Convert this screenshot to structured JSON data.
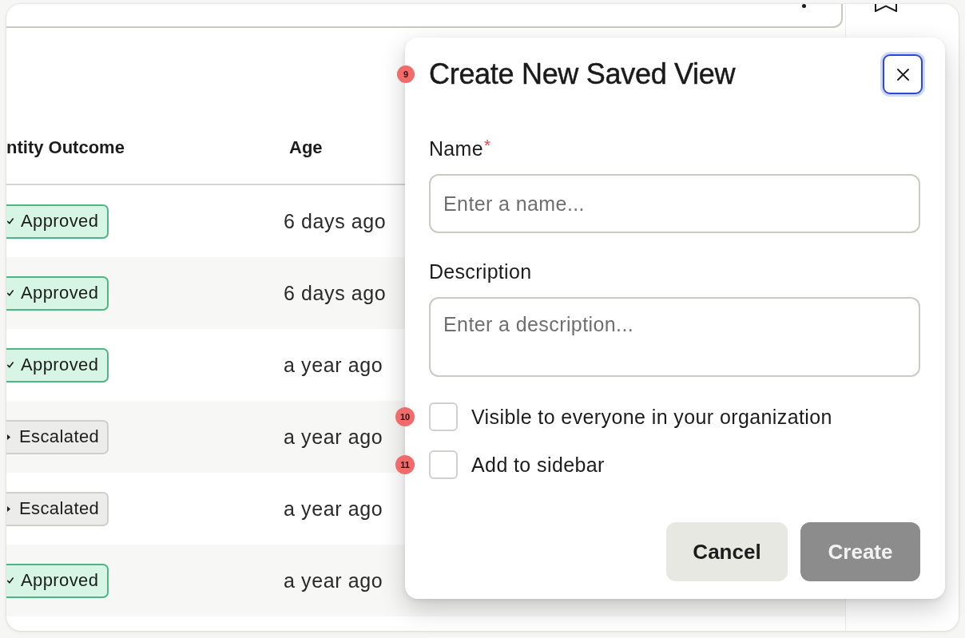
{
  "table": {
    "columns": [
      "ntity Outcome",
      "Age"
    ],
    "rows": [
      {
        "outcome": {
          "label": "Approved",
          "kind": "approved"
        },
        "age": "6 days ago"
      },
      {
        "outcome": {
          "label": "Approved",
          "kind": "approved"
        },
        "age": "6 days ago"
      },
      {
        "outcome": {
          "label": "Approved",
          "kind": "approved"
        },
        "age": "a year ago"
      },
      {
        "outcome": {
          "label": "Escalated",
          "kind": "escalated"
        },
        "age": "a year ago"
      },
      {
        "outcome": {
          "label": "Escalated",
          "kind": "escalated"
        },
        "age": "a year ago"
      },
      {
        "outcome": {
          "label": "Approved",
          "kind": "approved"
        },
        "age": "a year ago"
      }
    ]
  },
  "dialog": {
    "title": "Create New Saved View",
    "title_marker": "9",
    "fields": [
      {
        "kind": "input",
        "label": "Name",
        "required_mark": "*",
        "placeholder": "Enter a name..."
      },
      {
        "kind": "textarea",
        "label": "Description",
        "placeholder": "Enter a description..."
      }
    ],
    "checkboxes": [
      {
        "label": "Visible to everyone in your organization",
        "checked": false,
        "marker": "10"
      },
      {
        "label": "Add to sidebar",
        "checked": false,
        "marker": "11"
      }
    ],
    "buttons": [
      {
        "kind": "secondary",
        "label": "Cancel",
        "disabled": false
      },
      {
        "kind": "primary",
        "label": "Create",
        "disabled": true
      }
    ]
  }
}
